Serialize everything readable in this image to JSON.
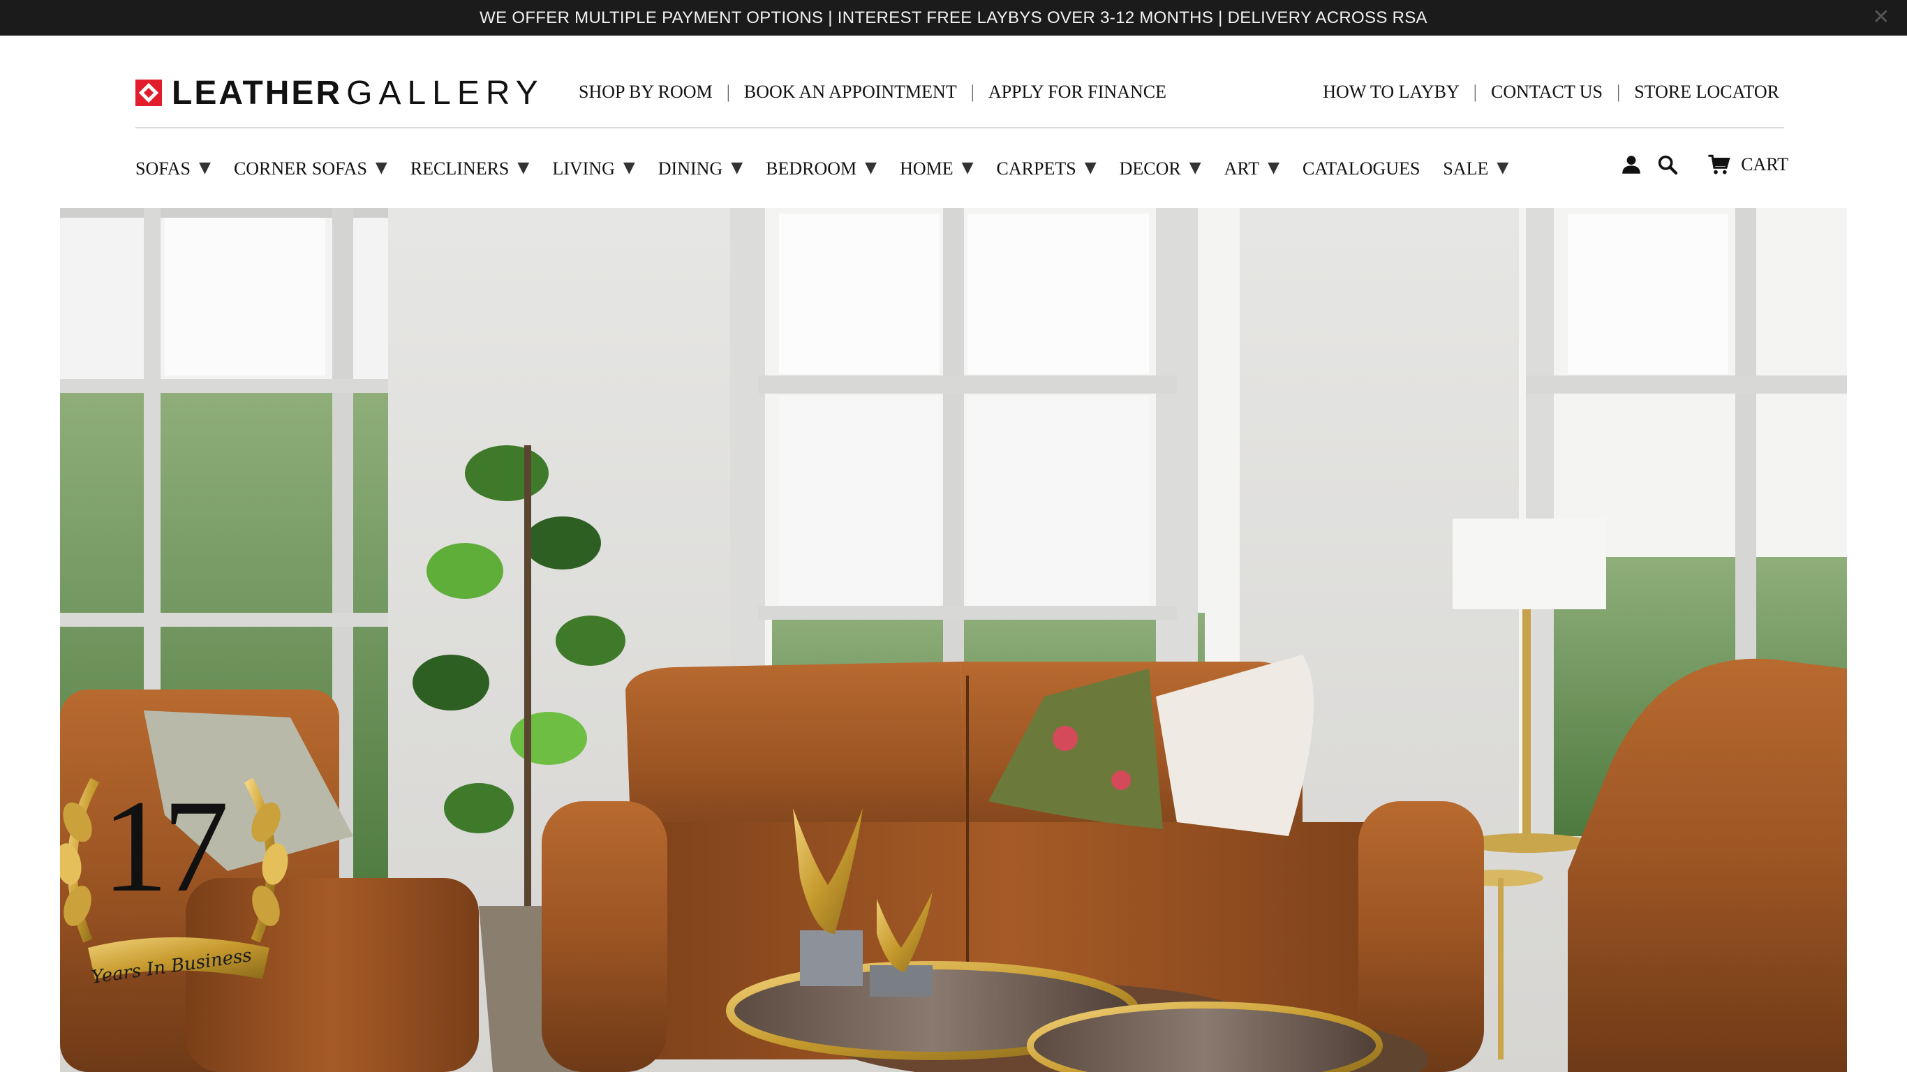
{
  "announcement": {
    "text": "WE OFFER MULTIPLE PAYMENT OPTIONS | INTEREST FREE LAYBYS OVER 3-12 MONTHS | DELIVERY ACROSS RSA",
    "close_icon": "close-icon"
  },
  "brand": {
    "bold": "LEATHER",
    "light": "GALLERY",
    "accent": "#e11d2b"
  },
  "util_left": [
    "SHOP BY ROOM",
    "BOOK AN APPOINTMENT",
    "APPLY FOR FINANCE"
  ],
  "util_right": [
    "HOW TO LAYBY",
    "CONTACT US",
    "STORE LOCATOR"
  ],
  "separator": "|",
  "main_nav": [
    {
      "label": "SOFAS",
      "caret": "▼"
    },
    {
      "label": "CORNER SOFAS",
      "caret": "▼"
    },
    {
      "label": "RECLINERS",
      "caret": "▼"
    },
    {
      "label": "LIVING",
      "caret": "▼"
    },
    {
      "label": "DINING",
      "caret": "▼"
    },
    {
      "label": "BEDROOM",
      "caret": "▼"
    },
    {
      "label": "HOME",
      "caret": "▼"
    },
    {
      "label": "CARPETS",
      "caret": "▼"
    },
    {
      "label": "DECOR",
      "caret": "▼"
    },
    {
      "label": "ART",
      "caret": "▼"
    },
    {
      "label": "CATALOGUES",
      "caret": ""
    },
    {
      "label": "SALE",
      "caret": "▼"
    }
  ],
  "header_icons": {
    "account": "account-icon",
    "search": "search-icon",
    "cart": "cart-icon",
    "cart_label": "CART"
  },
  "badge": {
    "number": "17",
    "ribbon": "Years In Business"
  }
}
